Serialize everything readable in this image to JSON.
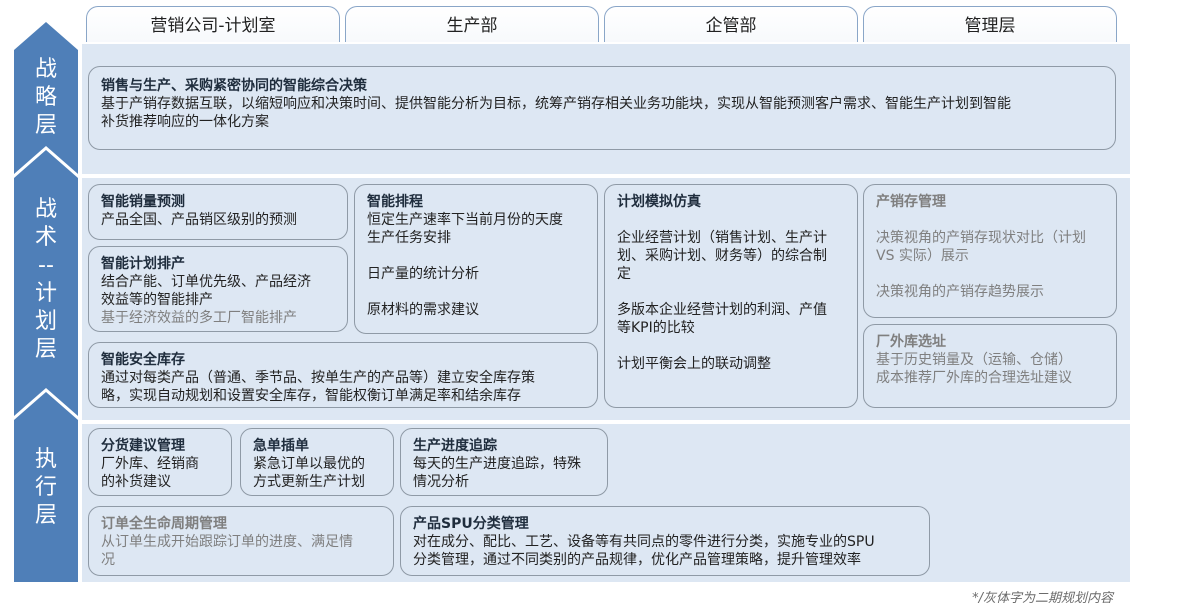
{
  "columns": [
    "营销公司-计划室",
    "生产部",
    "企管部",
    "管理层"
  ],
  "layers": {
    "strategy": "战\n略\n层",
    "tactics": "战\n术\n--\n计\n划\n层",
    "execution": "执\n行\n层"
  },
  "strategy_box": {
    "title": "销售与生产、采购紧密协同的智能综合决策",
    "line1": "基于产销存数据互联，以缩短响应和决策时间、提供智能分析为目标，统筹产销存相关业务功能块，实现从智能预测客户需求、智能生产计划到智能",
    "line2": "补货推荐响应的一体化方案"
  },
  "tactics": {
    "sales_forecast": {
      "title": "智能销量预测",
      "l1": "产品全国、产品销区级别的预测"
    },
    "plan_schedule": {
      "title": "智能计划排产",
      "l1": "结合产能、订单优先级、产品经济",
      "l2": "效益等的智能排产",
      "l3": "基于经济效益的多工厂智能排产"
    },
    "smart_schedule": {
      "title": "智能排程",
      "l1": "恒定生产速率下当前月份的天度",
      "l2": "生产任务安排",
      "l3": "日产量的统计分析",
      "l4": "原材料的需求建议"
    },
    "plan_sim": {
      "title": "计划模拟仿真",
      "l1": "企业经营计划（销售计划、生产计",
      "l2": "划、采购计划、财务等）的综合制",
      "l3": "定",
      "l4": "多版本企业经营计划的利润、产值",
      "l5": "等KPI的比较",
      "l6": "计划平衡会上的联动调整"
    },
    "psi_mgmt": {
      "title": "产销存管理",
      "l1": "决策视角的产销存现状对比（计划",
      "l2": "VS 实际）展示",
      "l3": "决策视角的产销存趋势展示"
    },
    "safety_stock": {
      "title": "智能安全库存",
      "l1": "通过对每类产品（普通、季节品、按单生产的产品等）建立安全库存策",
      "l2": "略，实现自动规划和设置安全库存，智能权衡订单满足率和结余库存"
    },
    "warehouse_site": {
      "title": "厂外库选址",
      "l1": "基于历史销量及（运输、仓储）",
      "l2": "成本推荐厂外库的合理选址建议"
    }
  },
  "execution": {
    "replenish": {
      "title": "分货建议管理",
      "l1": "厂外库、经销商",
      "l2": "的补货建议"
    },
    "urgent": {
      "title": "急单插单",
      "l1": "紧急订单以最优的",
      "l2": "方式更新生产计划"
    },
    "progress": {
      "title": "生产进度追踪",
      "l1": "每天的生产进度追踪，特殊",
      "l2": "情况分析"
    },
    "order_lifecycle": {
      "title": "订单全生命周期管理",
      "l1": "从订单生成开始跟踪订单的进度、满足情",
      "l2": "况"
    },
    "spu": {
      "title": "产品SPU分类管理",
      "l1": "对在成分、配比、工艺、设备等有共同点的零件进行分类，实施专业的SPU",
      "l2": "分类管理，通过不同类别的产品规律，优化产品管理策略，提升管理效率"
    }
  },
  "footnote": "*/灰体字为二期规划内容",
  "colors": {
    "layer_bg": "#dde7f3",
    "chevron": "#4f7fb8",
    "border": "#8f9aa6",
    "phase2_text": "#7f7f7f"
  }
}
